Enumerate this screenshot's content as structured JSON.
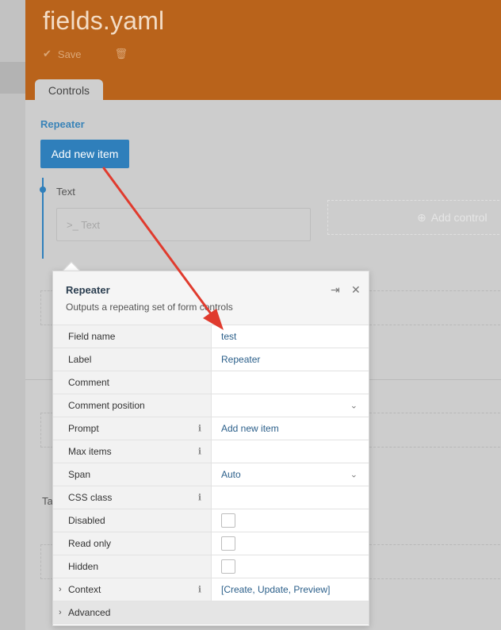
{
  "header": {
    "title": "fields.yaml",
    "save_label": "Save",
    "tab_label": "Controls"
  },
  "builder": {
    "field_label": "Repeater",
    "add_item_button": "Add new item",
    "text_label": "Text",
    "text_input_placeholder": ">_ Text",
    "add_control_label": "Add control",
    "fragment_label": "Ta"
  },
  "panel": {
    "title": "Repeater",
    "description": "Outputs a repeating set of form controls",
    "rows": [
      {
        "label": "Field name",
        "value": "test",
        "info": false,
        "control": "text"
      },
      {
        "label": "Label",
        "value": "Repeater",
        "info": false,
        "control": "text"
      },
      {
        "label": "Comment",
        "value": "",
        "info": false,
        "control": "text"
      },
      {
        "label": "Comment position",
        "value": "",
        "info": false,
        "control": "dropdown"
      },
      {
        "label": "Prompt",
        "value": "Add new item",
        "info": true,
        "control": "text"
      },
      {
        "label": "Max items",
        "value": "",
        "info": true,
        "control": "text"
      },
      {
        "label": "Span",
        "value": "Auto",
        "info": false,
        "control": "dropdown"
      },
      {
        "label": "CSS class",
        "value": "",
        "info": true,
        "control": "text"
      },
      {
        "label": "Disabled",
        "value": "",
        "info": false,
        "control": "checkbox"
      },
      {
        "label": "Read only",
        "value": "",
        "info": false,
        "control": "checkbox"
      },
      {
        "label": "Hidden",
        "value": "",
        "info": false,
        "control": "checkbox"
      },
      {
        "label": "Context",
        "value": "[Create, Update, Preview]",
        "info": true,
        "control": "text",
        "expandable": true
      },
      {
        "label": "Advanced",
        "value": "",
        "info": false,
        "control": "section",
        "expandable": true
      }
    ]
  },
  "colors": {
    "header_bg": "#b9631b",
    "accent_blue": "#2f7fbb",
    "arrow_red": "#e03b2e"
  }
}
